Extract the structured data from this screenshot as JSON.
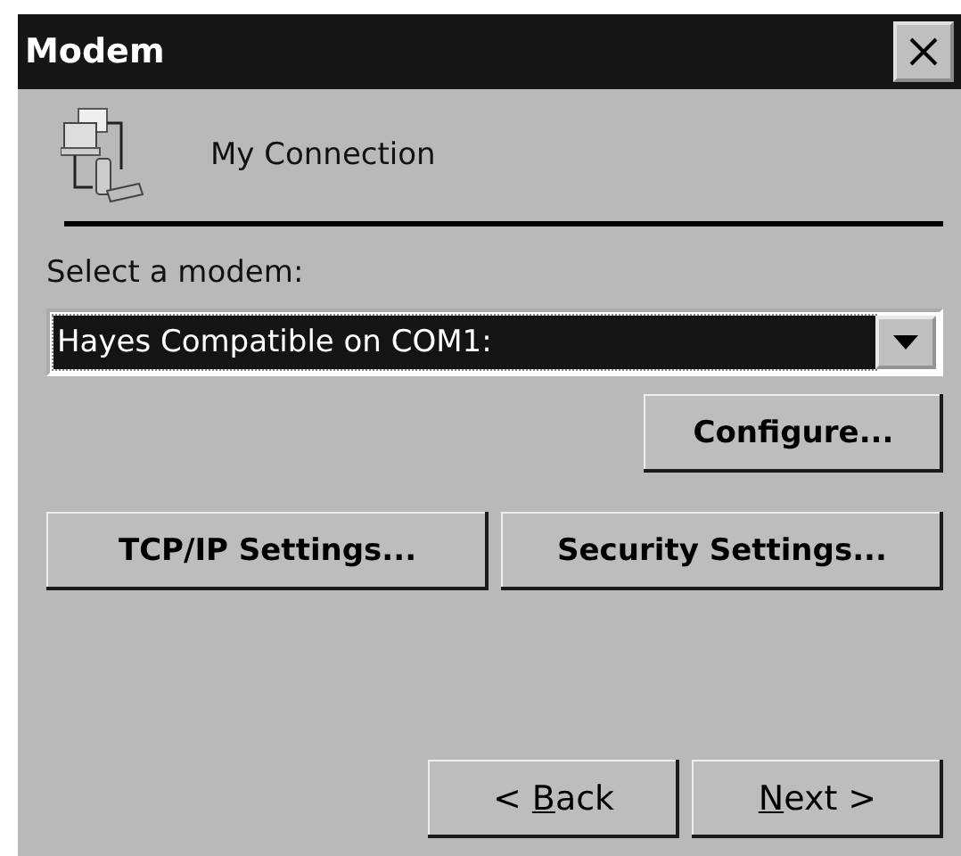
{
  "window": {
    "title": "Modem"
  },
  "connection": {
    "name": "My Connection"
  },
  "modem_select": {
    "label": "Select a modem:",
    "value": "Hayes Compatible on COM1:",
    "highlighted": true
  },
  "configure_button": {
    "label": "Configure..."
  },
  "settings_buttons": [
    {
      "label": "TCP/IP Settings..."
    },
    {
      "label": "Security Settings..."
    }
  ],
  "nav_buttons": [
    {
      "label_before": "< ",
      "access_key": "B",
      "label_after": "ack"
    },
    {
      "access_key": "N",
      "label_after": "ext >"
    }
  ]
}
